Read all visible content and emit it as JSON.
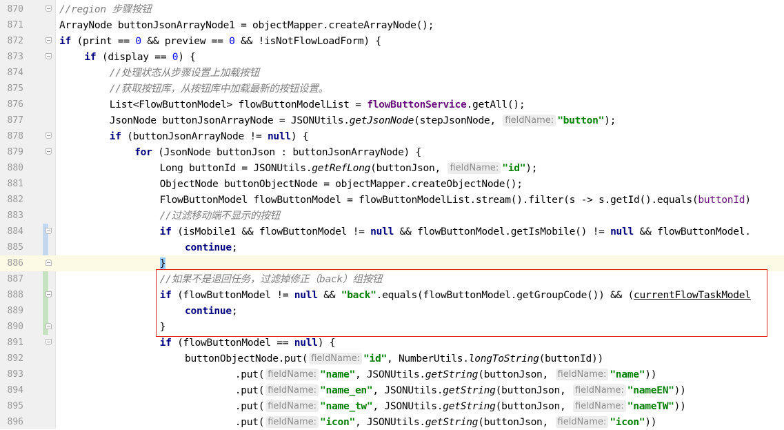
{
  "editor": {
    "lines": [
      {
        "n": "870",
        "indent": 0,
        "tokens": [
          {
            "t": "cm",
            "v": "//region 步骤按钮"
          }
        ]
      },
      {
        "n": "871",
        "indent": 0,
        "tokens": [
          {
            "t": "tx",
            "v": "ArrayNode buttonJsonArrayNode1 = objectMapper.createArrayNode();"
          }
        ]
      },
      {
        "n": "872",
        "indent": 0,
        "tokens": [
          {
            "t": "kw",
            "v": "if"
          },
          {
            "t": "tx",
            "v": " (print == "
          },
          {
            "t": "num",
            "v": "0"
          },
          {
            "t": "tx",
            "v": " && preview == "
          },
          {
            "t": "num",
            "v": "0"
          },
          {
            "t": "tx",
            "v": " && !isNotFlowLoadForm) {"
          }
        ]
      },
      {
        "n": "873",
        "indent": 4,
        "tokens": [
          {
            "t": "kw",
            "v": "if"
          },
          {
            "t": "tx",
            "v": " (display == "
          },
          {
            "t": "num",
            "v": "0"
          },
          {
            "t": "tx",
            "v": ") {"
          }
        ]
      },
      {
        "n": "874",
        "indent": 8,
        "tokens": [
          {
            "t": "cm",
            "v": "//处理状态从步骤设置上加载按钮"
          }
        ]
      },
      {
        "n": "875",
        "indent": 8,
        "tokens": [
          {
            "t": "cm",
            "v": "//获取按钮库，从按钮库中加载最新的按钮设置。"
          }
        ]
      },
      {
        "n": "876",
        "indent": 8,
        "tokens": [
          {
            "t": "tx",
            "v": "List<FlowButtonModel> flowButtonModelList = "
          },
          {
            "t": "fld",
            "v": "flowButtonService"
          },
          {
            "t": "tx",
            "v": ".getAll();"
          }
        ]
      },
      {
        "n": "877",
        "indent": 8,
        "tokens": [
          {
            "t": "tx",
            "v": "JsonNode buttonJsonArrayNode = JSONUtils."
          },
          {
            "t": "it",
            "v": "getJsonNode"
          },
          {
            "t": "tx",
            "v": "(stepJsonNode, "
          },
          {
            "t": "hint",
            "v": "fieldName:"
          },
          {
            "t": "str",
            "v": "\"button\""
          },
          {
            "t": "tx",
            "v": ");"
          }
        ]
      },
      {
        "n": "878",
        "indent": 8,
        "tokens": [
          {
            "t": "kw",
            "v": "if"
          },
          {
            "t": "tx",
            "v": " (buttonJsonArrayNode != "
          },
          {
            "t": "kw",
            "v": "null"
          },
          {
            "t": "tx",
            "v": ") {"
          }
        ]
      },
      {
        "n": "879",
        "indent": 12,
        "tokens": [
          {
            "t": "kw",
            "v": "for"
          },
          {
            "t": "tx",
            "v": " (JsonNode buttonJson : buttonJsonArrayNode) {"
          }
        ]
      },
      {
        "n": "880",
        "indent": 16,
        "tokens": [
          {
            "t": "tx",
            "v": "Long buttonId = JSONUtils."
          },
          {
            "t": "it",
            "v": "getRefLong"
          },
          {
            "t": "tx",
            "v": "(buttonJson, "
          },
          {
            "t": "hint",
            "v": "fieldName:"
          },
          {
            "t": "str",
            "v": "\"id\""
          },
          {
            "t": "tx",
            "v": ");"
          }
        ]
      },
      {
        "n": "881",
        "indent": 16,
        "tokens": [
          {
            "t": "tx",
            "v": "ObjectNode buttonObjectNode = objectMapper.createObjectNode();"
          }
        ]
      },
      {
        "n": "882",
        "indent": 16,
        "tokens": [
          {
            "t": "tx",
            "v": "FlowButtonModel flowButtonModel = flowButtonModelList.stream().filter(s -> s.getId().equals("
          },
          {
            "t": "par",
            "v": "buttonId"
          },
          {
            "t": "tx",
            "v": ")"
          }
        ]
      },
      {
        "n": "883",
        "indent": 16,
        "tokens": [
          {
            "t": "cm",
            "v": "//过滤移动端不显示的按钮"
          }
        ]
      },
      {
        "n": "884",
        "indent": 16,
        "tokens": [
          {
            "t": "kw",
            "v": "if"
          },
          {
            "t": "tx",
            "v": " (isMobile1 && flowButtonModel != "
          },
          {
            "t": "kw",
            "v": "null"
          },
          {
            "t": "tx",
            "v": " && flowButtonModel.getIsMobile() != "
          },
          {
            "t": "kw",
            "v": "null"
          },
          {
            "t": "tx",
            "v": " && flowButtonModel."
          }
        ]
      },
      {
        "n": "885",
        "indent": 20,
        "tokens": [
          {
            "t": "kw",
            "v": "continue"
          },
          {
            "t": "tx",
            "v": ";"
          }
        ]
      },
      {
        "n": "886",
        "indent": 16,
        "tokens": [
          {
            "t": "brace",
            "v": "}"
          }
        ]
      },
      {
        "n": "887",
        "indent": 16,
        "tokens": [
          {
            "t": "cm",
            "v": "//如果不是退回任务，过滤掉修正（back）组按钮"
          }
        ]
      },
      {
        "n": "888",
        "indent": 16,
        "tokens": [
          {
            "t": "kw",
            "v": "if"
          },
          {
            "t": "tx",
            "v": " (flowButtonModel != "
          },
          {
            "t": "kw",
            "v": "null"
          },
          {
            "t": "tx",
            "v": " && "
          },
          {
            "t": "str",
            "v": "\"back\""
          },
          {
            "t": "tx",
            "v": ".equals(flowButtonModel.getGroupCode()) && ("
          },
          {
            "t": "ul",
            "v": "currentFlowTaskModel"
          }
        ]
      },
      {
        "n": "889",
        "indent": 20,
        "tokens": [
          {
            "t": "kw",
            "v": "continue"
          },
          {
            "t": "tx",
            "v": ";"
          }
        ]
      },
      {
        "n": "890",
        "indent": 16,
        "tokens": [
          {
            "t": "tx",
            "v": "}"
          }
        ]
      },
      {
        "n": "891",
        "indent": 16,
        "tokens": [
          {
            "t": "kw",
            "v": "if"
          },
          {
            "t": "tx",
            "v": " (flowButtonModel == "
          },
          {
            "t": "kw",
            "v": "null"
          },
          {
            "t": "tx",
            "v": ") {"
          }
        ]
      },
      {
        "n": "892",
        "indent": 20,
        "tokens": [
          {
            "t": "tx",
            "v": "buttonObjectNode.put("
          },
          {
            "t": "hint",
            "v": "fieldName:"
          },
          {
            "t": "str",
            "v": "\"id\""
          },
          {
            "t": "tx",
            "v": ", NumberUtils."
          },
          {
            "t": "it",
            "v": "longToString"
          },
          {
            "t": "tx",
            "v": "(buttonId))"
          }
        ]
      },
      {
        "n": "893",
        "indent": 28,
        "tokens": [
          {
            "t": "tx",
            "v": ".put("
          },
          {
            "t": "hint",
            "v": "fieldName:"
          },
          {
            "t": "str",
            "v": "\"name\""
          },
          {
            "t": "tx",
            "v": ", JSONUtils."
          },
          {
            "t": "it",
            "v": "getString"
          },
          {
            "t": "tx",
            "v": "(buttonJson, "
          },
          {
            "t": "hint",
            "v": "fieldName:"
          },
          {
            "t": "str",
            "v": "\"name\""
          },
          {
            "t": "tx",
            "v": "))"
          }
        ]
      },
      {
        "n": "894",
        "indent": 28,
        "tokens": [
          {
            "t": "tx",
            "v": ".put("
          },
          {
            "t": "hint",
            "v": "fieldName:"
          },
          {
            "t": "str",
            "v": "\"name_en\""
          },
          {
            "t": "tx",
            "v": ", JSONUtils."
          },
          {
            "t": "it",
            "v": "getString"
          },
          {
            "t": "tx",
            "v": "(buttonJson, "
          },
          {
            "t": "hint",
            "v": "fieldName:"
          },
          {
            "t": "str",
            "v": "\"nameEN\""
          },
          {
            "t": "tx",
            "v": "))"
          }
        ]
      },
      {
        "n": "895",
        "indent": 28,
        "tokens": [
          {
            "t": "tx",
            "v": ".put("
          },
          {
            "t": "hint",
            "v": "fieldName:"
          },
          {
            "t": "str",
            "v": "\"name_tw\""
          },
          {
            "t": "tx",
            "v": ", JSONUtils."
          },
          {
            "t": "it",
            "v": "getString"
          },
          {
            "t": "tx",
            "v": "(buttonJson, "
          },
          {
            "t": "hint",
            "v": "fieldName:"
          },
          {
            "t": "str",
            "v": "\"nameTW\""
          },
          {
            "t": "tx",
            "v": "))"
          }
        ]
      },
      {
        "n": "896",
        "indent": 28,
        "tokens": [
          {
            "t": "tx",
            "v": ".put("
          },
          {
            "t": "hint",
            "v": "fieldName:"
          },
          {
            "t": "str",
            "v": "\"icon\""
          },
          {
            "t": "tx",
            "v": ", JSONUtils."
          },
          {
            "t": "it",
            "v": "getString"
          },
          {
            "t": "tx",
            "v": "(buttonJson, "
          },
          {
            "t": "hint",
            "v": "fieldName:"
          },
          {
            "t": "str",
            "v": "\"icon\""
          },
          {
            "t": "tx",
            "v": "))"
          }
        ]
      }
    ]
  }
}
